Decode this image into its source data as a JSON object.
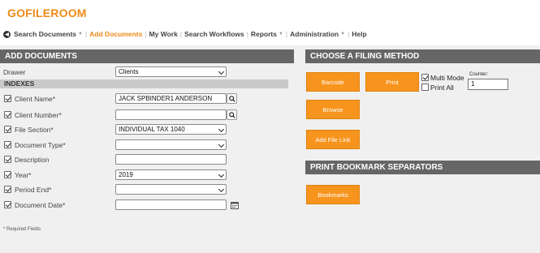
{
  "app": {
    "logo": "GOFILEROOM"
  },
  "nav": {
    "items": [
      {
        "label": "Search Documents",
        "caret": true
      },
      {
        "label": "Add Documents",
        "caret": false,
        "active": true
      },
      {
        "label": "My Work",
        "caret": false
      },
      {
        "label": "Search Workflows",
        "caret": false
      },
      {
        "label": "Reports",
        "caret": true
      },
      {
        "label": "Administration",
        "caret": true
      },
      {
        "label": "Help",
        "caret": false
      }
    ]
  },
  "add_documents": {
    "title": "ADD DOCUMENTS",
    "drawer_label": "Drawer",
    "drawer_value": "Clients",
    "indexes_title": "INDEXES",
    "fields": [
      {
        "label": "Client Name*",
        "value": "JACK SPBINDER1 ANDERSON",
        "type": "text",
        "lookup": true
      },
      {
        "label": "Client Number*",
        "value": "",
        "type": "text",
        "lookup": true
      },
      {
        "label": "File Section*",
        "value": "INDIVIDUAL TAX 1040",
        "type": "select"
      },
      {
        "label": "Document Type*",
        "value": "",
        "type": "select"
      },
      {
        "label": "Description",
        "value": "",
        "type": "text"
      },
      {
        "label": "Year*",
        "value": "2019",
        "type": "select"
      },
      {
        "label": "Period End*",
        "value": "",
        "type": "select"
      },
      {
        "label": "Document Date*",
        "value": "",
        "type": "text",
        "calendar": true
      }
    ],
    "required_note": "* Required Fields"
  },
  "filing": {
    "title": "CHOOSE A FILING METHOD",
    "barcode_label": "Barcode",
    "print_label": "Print",
    "multi_mode_label": "Multi Mode",
    "multi_mode_checked": true,
    "print_all_label": "Print All",
    "print_all_checked": false,
    "counter_label": "Counter:",
    "counter_value": "1",
    "browse_label": "Browse",
    "add_file_link_label": "Add File Link"
  },
  "bookmarks": {
    "title": "PRINT BOOKMARK SEPARATORS",
    "button_label": "Bookmarks"
  },
  "colors": {
    "accent": "#f7941d",
    "header_bg": "#666666",
    "logo": "#ef8a17"
  }
}
